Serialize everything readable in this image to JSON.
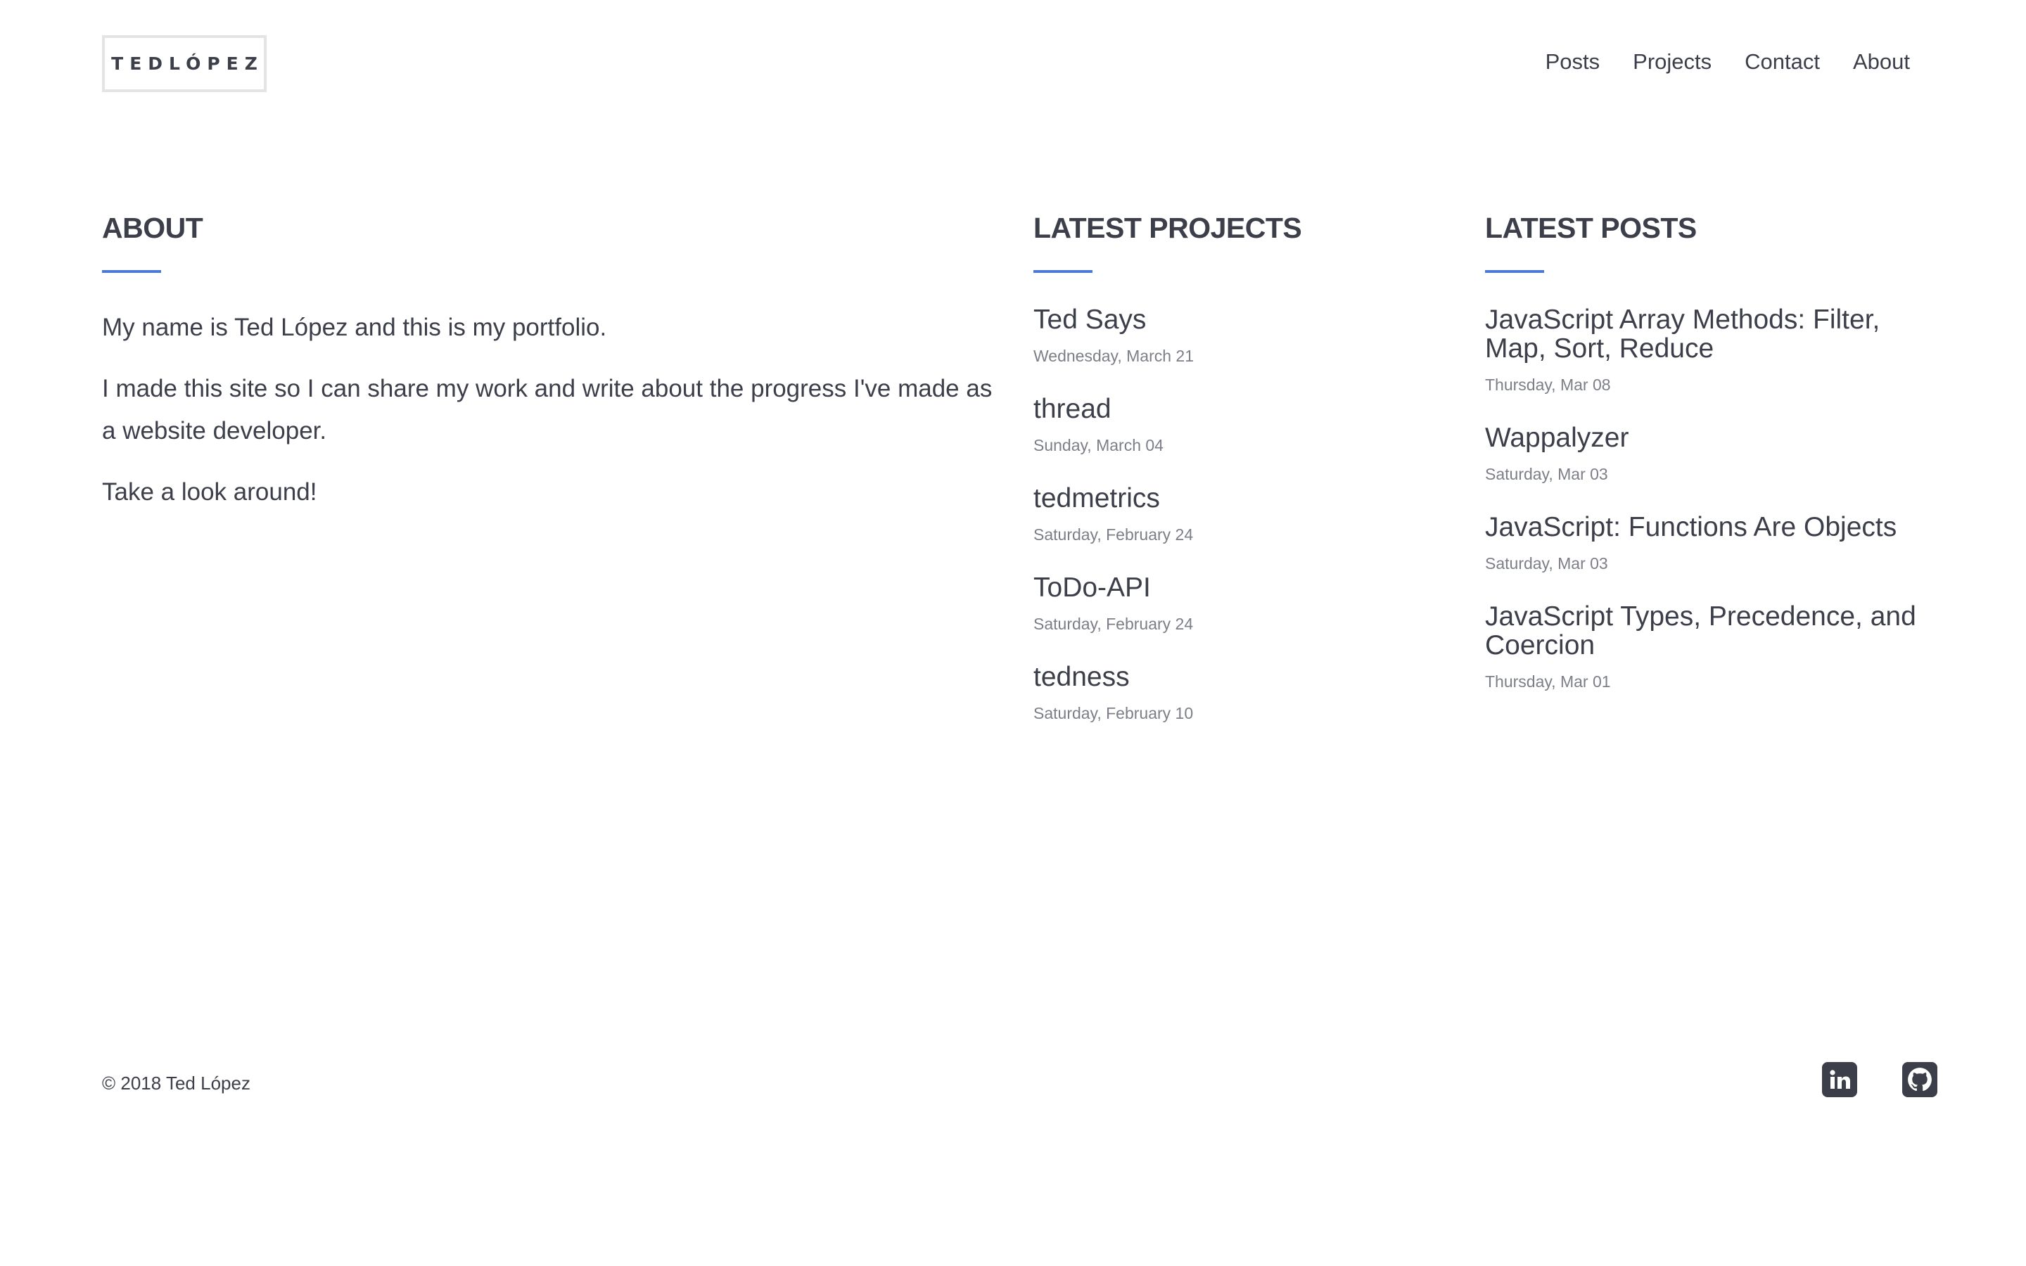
{
  "header": {
    "logo": "TEDLÓPEZ",
    "nav": [
      "Posts",
      "Projects",
      "Contact",
      "About"
    ]
  },
  "about": {
    "title": "ABOUT",
    "paragraphs": [
      "My name is Ted López and this is my portfolio.",
      "I made this site so I can share my work and write about the progress I've made as a website developer.",
      "Take a look around!"
    ]
  },
  "projects": {
    "title": "LATEST PROJECTS",
    "items": [
      {
        "title": "Ted Says",
        "date": "Wednesday, March 21"
      },
      {
        "title": "thread",
        "date": "Sunday, March 04"
      },
      {
        "title": "tedmetrics",
        "date": "Saturday, February 24"
      },
      {
        "title": "ToDo-API",
        "date": "Saturday, February 24"
      },
      {
        "title": "tedness",
        "date": "Saturday, February 10"
      }
    ]
  },
  "posts": {
    "title": "LATEST POSTS",
    "items": [
      {
        "title": "JavaScript Array Methods: Filter, Map, Sort, Reduce",
        "date": "Thursday, Mar 08"
      },
      {
        "title": "Wappalyzer",
        "date": "Saturday, Mar 03"
      },
      {
        "title": "JavaScript: Functions Are Objects",
        "date": "Saturday, Mar 03"
      },
      {
        "title": "JavaScript Types, Precedence, and Coercion",
        "date": "Thursday, Mar 01"
      }
    ]
  },
  "footer": {
    "copyright": "© 2018 Ted López",
    "social": [
      "linkedin-icon",
      "github-icon"
    ]
  },
  "colors": {
    "text": "#3c3f4a",
    "accent": "#4a79d6",
    "muted": "#7c7f88",
    "border": "#e4e4e4"
  }
}
